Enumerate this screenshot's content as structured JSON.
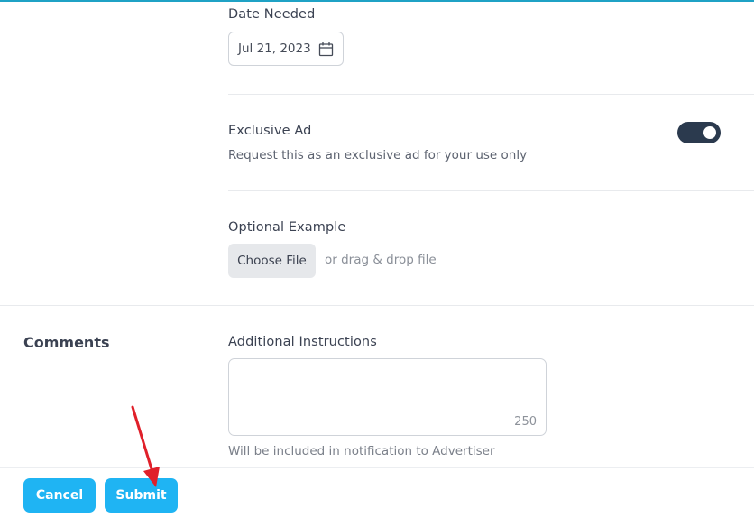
{
  "date_needed": {
    "label": "Date Needed",
    "value": "Jul 21, 2023",
    "icon": "calendar-icon"
  },
  "exclusive_ad": {
    "label": "Exclusive Ad",
    "description": "Request this as an exclusive ad for your use only",
    "toggle_on": true,
    "toggle_color": "#2b3a4e"
  },
  "optional_example": {
    "label": "Optional Example",
    "button_label": "Choose File",
    "drop_text": "or drag & drop file"
  },
  "comments": {
    "section_title": "Comments",
    "field_label": "Additional Instructions",
    "value": "",
    "char_counter": "250",
    "hint": "Will be included in notification to Advertiser"
  },
  "footer": {
    "cancel_label": "Cancel",
    "submit_label": "Submit",
    "button_color": "#1fb4f3"
  },
  "annotation": {
    "type": "arrow",
    "color": "#e0202a",
    "points_to": "submit-button"
  },
  "accent_color": "#1fa2c5"
}
